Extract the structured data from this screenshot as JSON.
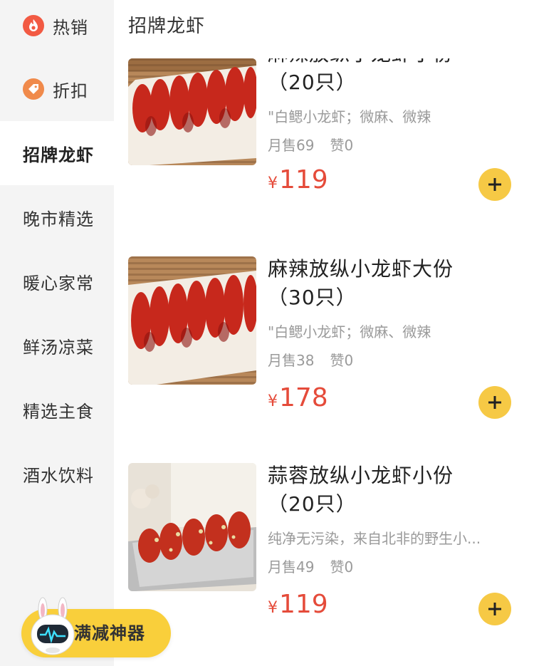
{
  "sidebar": {
    "items": [
      {
        "label": "热销",
        "icon": "flame-icon"
      },
      {
        "label": "折扣",
        "icon": "discount-tag-icon"
      },
      {
        "label": "招牌龙虾",
        "active": true
      },
      {
        "label": "晚市精选"
      },
      {
        "label": "暖心家常"
      },
      {
        "label": "鲜汤凉菜"
      },
      {
        "label": "精选主食"
      },
      {
        "label": "酒水饮料"
      }
    ]
  },
  "section": {
    "title": "招牌龙虾"
  },
  "items": [
    {
      "name_line1": "麻辣放纵小龙虾小份",
      "name_line2": "（20只）",
      "desc": "\"白鳃小龙虾；微麻、微辣",
      "sales": "月售69",
      "likes": "赞0",
      "currency": "¥",
      "price": "119"
    },
    {
      "name_line1": "麻辣放纵小龙虾大份",
      "name_line2": "（30只）",
      "desc": "\"白鳃小龙虾；微麻、微辣",
      "sales": "月售38",
      "likes": "赞0",
      "currency": "¥",
      "price": "178"
    },
    {
      "name_line1": "蒜蓉放纵小龙虾小份",
      "name_line2": "（20只）",
      "desc": "纯净无污染，来自北非的野生小...",
      "sales": "月售49",
      "likes": "赞0",
      "currency": "¥",
      "price": "119"
    }
  ],
  "promo": {
    "label": "满减神器"
  },
  "colors": {
    "price": "#e54b3a",
    "accent_yellow": "#f6c945",
    "sidebar_bg": "#f4f4f4",
    "icon_red": "#f25a43",
    "icon_orange": "#f08a4b"
  }
}
